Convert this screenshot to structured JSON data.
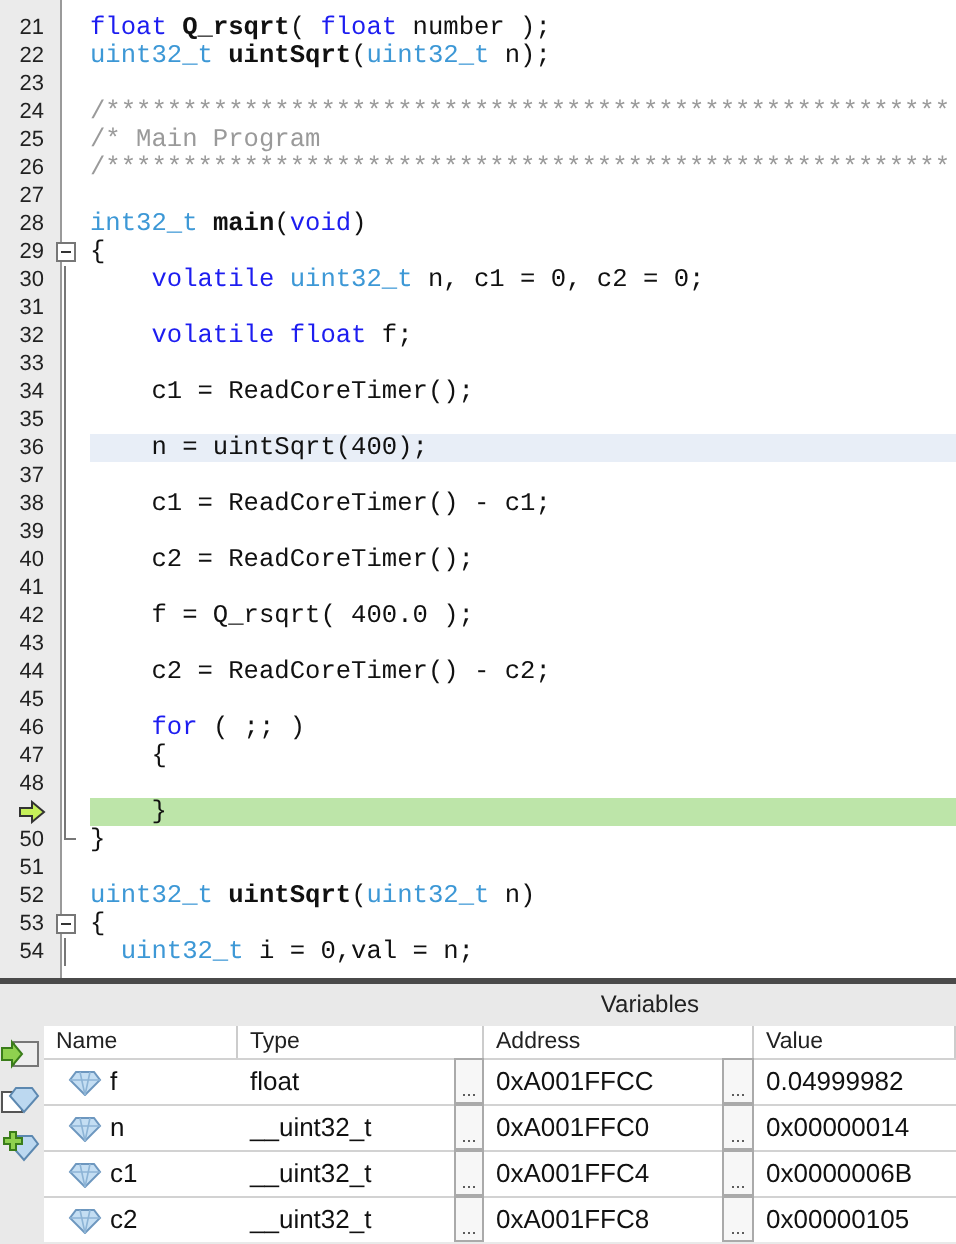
{
  "editor": {
    "lines": [
      {
        "number": "21",
        "tokens": [
          {
            "kind": "kw",
            "text": "float"
          },
          {
            "kind": "fn",
            "text": " Q_rsqrt"
          },
          {
            "kind": "pl",
            "text": "( "
          },
          {
            "kind": "kw",
            "text": "float"
          },
          {
            "kind": "pl",
            "text": " number );"
          }
        ]
      },
      {
        "number": "22",
        "tokens": [
          {
            "kind": "type",
            "text": "uint32_t"
          },
          {
            "kind": "fn",
            "text": " uintSqrt"
          },
          {
            "kind": "pl",
            "text": "("
          },
          {
            "kind": "type",
            "text": "uint32_t"
          },
          {
            "kind": "pl",
            "text": " n);"
          }
        ]
      },
      {
        "number": "23"
      },
      {
        "number": "24",
        "tokens": [
          {
            "kind": "cm",
            "text": "/*******************************************************"
          }
        ]
      },
      {
        "number": "25",
        "tokens": [
          {
            "kind": "cm",
            "text": "/* Main Program"
          }
        ]
      },
      {
        "number": "26",
        "tokens": [
          {
            "kind": "cm",
            "text": "/*******************************************************"
          }
        ]
      },
      {
        "number": "27"
      },
      {
        "number": "28",
        "tokens": [
          {
            "kind": "type",
            "text": "int32_t"
          },
          {
            "kind": "fn",
            "text": " main"
          },
          {
            "kind": "pl",
            "text": "("
          },
          {
            "kind": "kw",
            "text": "void"
          },
          {
            "kind": "pl",
            "text": ")"
          }
        ]
      },
      {
        "number": "29",
        "fold_start": true,
        "tokens": [
          {
            "kind": "pl",
            "text": "{"
          }
        ]
      },
      {
        "number": "30",
        "fold_body": true,
        "tokens": [
          {
            "kind": "kw",
            "text": "    volatile"
          },
          {
            "kind": "type",
            "text": " uint32_t"
          },
          {
            "kind": "pl",
            "text": " n, c1 = 0, c2 = 0;"
          }
        ]
      },
      {
        "number": "31",
        "fold_body": true
      },
      {
        "number": "32",
        "fold_body": true,
        "tokens": [
          {
            "kind": "kw",
            "text": "    volatile float"
          },
          {
            "kind": "pl",
            "text": " f;"
          }
        ]
      },
      {
        "number": "33",
        "fold_body": true
      },
      {
        "number": "34",
        "fold_body": true,
        "tokens": [
          {
            "kind": "pl",
            "text": "    c1 = ReadCoreTimer();"
          }
        ]
      },
      {
        "number": "35",
        "fold_body": true
      },
      {
        "number": "36",
        "fold_body": true,
        "cursor": true,
        "tokens": [
          {
            "kind": "pl",
            "text": "    n = uintSqrt(400);"
          }
        ]
      },
      {
        "number": "37",
        "fold_body": true
      },
      {
        "number": "38",
        "fold_body": true,
        "tokens": [
          {
            "kind": "pl",
            "text": "    c1 = ReadCoreTimer() - c1;"
          }
        ]
      },
      {
        "number": "39",
        "fold_body": true
      },
      {
        "number": "40",
        "fold_body": true,
        "tokens": [
          {
            "kind": "pl",
            "text": "    c2 = ReadCoreTimer();"
          }
        ]
      },
      {
        "number": "41",
        "fold_body": true
      },
      {
        "number": "42",
        "fold_body": true,
        "tokens": [
          {
            "kind": "pl",
            "text": "    f = Q_rsqrt( 400.0 );"
          }
        ]
      },
      {
        "number": "43",
        "fold_body": true
      },
      {
        "number": "44",
        "fold_body": true,
        "tokens": [
          {
            "kind": "pl",
            "text": "    c2 = ReadCoreTimer() - c2;"
          }
        ]
      },
      {
        "number": "45",
        "fold_body": true
      },
      {
        "number": "46",
        "fold_body": true,
        "tokens": [
          {
            "kind": "kw",
            "text": "    for"
          },
          {
            "kind": "pl",
            "text": " ( ;; )"
          }
        ]
      },
      {
        "number": "47",
        "fold_body": true,
        "tokens": [
          {
            "kind": "pl",
            "text": "    {"
          }
        ]
      },
      {
        "number": "48",
        "fold_body": true
      },
      {
        "fold_body": true,
        "current": true,
        "tokens": [
          {
            "kind": "pl",
            "text": "    }"
          }
        ]
      },
      {
        "number": "50",
        "fold_end": true,
        "tokens": [
          {
            "kind": "pl",
            "text": "}"
          }
        ]
      },
      {
        "number": "51"
      },
      {
        "number": "52",
        "tokens": [
          {
            "kind": "type",
            "text": "uint32_t"
          },
          {
            "kind": "fn",
            "text": " uintSqrt"
          },
          {
            "kind": "pl",
            "text": "("
          },
          {
            "kind": "type",
            "text": "uint32_t"
          },
          {
            "kind": "pl",
            "text": " n)"
          }
        ]
      },
      {
        "number": "53",
        "fold_start": true,
        "tokens": [
          {
            "kind": "pl",
            "text": "{"
          }
        ]
      },
      {
        "number": "54",
        "fold_body": true,
        "tokens": [
          {
            "kind": "type",
            "text": "  uint32_t"
          },
          {
            "kind": "pl",
            "text": " i = 0,val = n;"
          }
        ]
      }
    ]
  },
  "variables": {
    "title": "Variables",
    "columns": [
      "Name",
      "Type",
      "Address",
      "Value"
    ],
    "rows": [
      {
        "name": "f",
        "type": "float",
        "type_edit": "...",
        "address": "0xA001FFCC",
        "address_edit": "...",
        "value": "0.04999982"
      },
      {
        "name": "n",
        "type": "__uint32_t",
        "type_edit": "...",
        "address": "0xA001FFC0",
        "address_edit": "...",
        "value": "0x00000014"
      },
      {
        "name": "c1",
        "type": "__uint32_t",
        "type_edit": "...",
        "address": "0xA001FFC4",
        "address_edit": "...",
        "value": "0x0000006B"
      },
      {
        "name": "c2",
        "type": "__uint32_t",
        "type_edit": "...",
        "address": "0xA001FFC8",
        "address_edit": "...",
        "value": "0x00000105"
      }
    ]
  }
}
